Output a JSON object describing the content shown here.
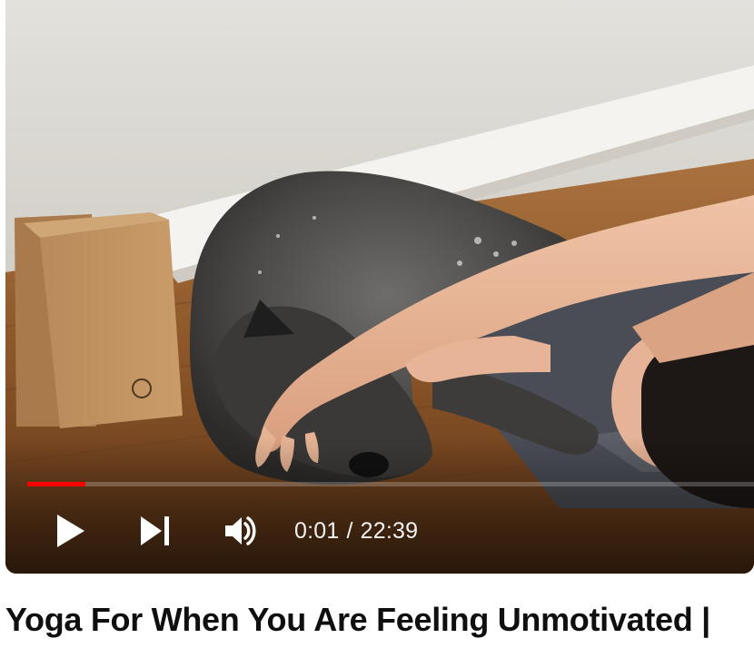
{
  "player": {
    "progress_fraction": 0.08,
    "buffer_fraction": 0.08,
    "accent_color": "#ff0000",
    "controls": {
      "play_icon": "play-icon",
      "next_icon": "next-icon",
      "volume_icon": "volume-icon"
    },
    "time": {
      "current": "0:01",
      "separator": "/",
      "duration": "22:39"
    }
  },
  "video": {
    "title": "Yoga For When You Are Feeling Unmotivated |"
  }
}
